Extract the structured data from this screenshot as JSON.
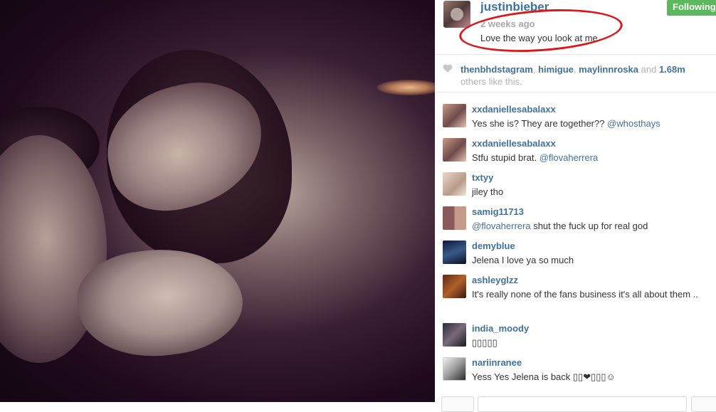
{
  "post": {
    "owner": "justinbieber",
    "time": "2 weeks ago",
    "caption": "Love the way you look at me",
    "follow_label": "Following",
    "highlight_color": "#d9191c"
  },
  "likes": {
    "users": [
      "thenbhdstagram",
      "himigue",
      "maylinnroska"
    ],
    "sep": ", ",
    "and": "and",
    "count": "1.68m",
    "suffix": "others like this."
  },
  "comments": [
    {
      "user": "xxdaniellesabalaxx",
      "text": "Yes she is? They are together??",
      "mention": "@whosthays"
    },
    {
      "user": "xxdaniellesabalaxx",
      "text": "Stfu stupid brat.",
      "mention": "@flovaherrera"
    },
    {
      "user": "txtyy",
      "text": "jiley tho",
      "mention": ""
    },
    {
      "user": "samig11713",
      "mention_lead": "@flovaherrera",
      "text": "shut the fuck up for real god"
    },
    {
      "user": "demyblue",
      "text": "Jelena I love ya so much",
      "mention": ""
    },
    {
      "user": "ashleyglzz",
      "text": "It's really none of the fans business it's all about them ..",
      "mention": ""
    },
    {
      "user": "india_moody",
      "text": "▯▯▯▯▯",
      "mention": ""
    },
    {
      "user": "nariinranee",
      "text": "Yess Yes Jelena is back ▯▯❤▯▯▯☺",
      "mention": ""
    }
  ],
  "icons": {
    "heart": "heart-icon"
  }
}
